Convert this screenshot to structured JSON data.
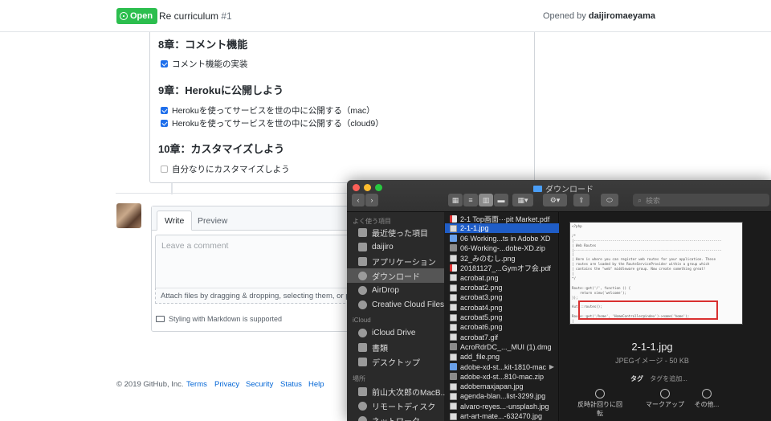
{
  "issue": {
    "state_label": "Open",
    "title": "Re curriculum",
    "number": "#1",
    "opened_by_prefix": "Opened by",
    "author": "daijiromaeyama"
  },
  "body": {
    "sections": [
      {
        "heading": "8章：コメント機能",
        "tasks": [
          {
            "text": "コメント機能の実装",
            "checked": true
          }
        ]
      },
      {
        "heading": "9章：Herokuに公開しよう",
        "tasks": [
          {
            "text": "Herokuを使ってサービスを世の中に公開する（mac）",
            "checked": true
          },
          {
            "text": "Herokuを使ってサービスを世の中に公開する（cloud9）",
            "checked": true
          }
        ]
      },
      {
        "heading": "10章：カスタマイズしよう",
        "tasks": [
          {
            "text": "自分なりにカスタマイズしよう",
            "checked": false
          }
        ]
      }
    ]
  },
  "new_comment": {
    "tab_write": "Write",
    "tab_preview": "Preview",
    "placeholder": "Leave a comment",
    "attach_text": "Attach files by dragging & dropping, selecting them, or p",
    "markdown_note": "Styling with Markdown is supported"
  },
  "footer": {
    "copyright": "© 2019 GitHub, Inc.",
    "links": [
      "Terms",
      "Privacy",
      "Security",
      "Status",
      "Help"
    ]
  },
  "finder": {
    "window_title": "ダウンロード",
    "search_placeholder": "検索",
    "sidebar": {
      "favorites_label": "よく使う項目",
      "favorites": [
        "最近使った項目",
        "daijiro",
        "アプリケーション",
        "ダウンロード",
        "AirDrop",
        "Creative Cloud Files"
      ],
      "selected": "ダウンロード",
      "icloud_label": "iCloud",
      "icloud": [
        "iCloud Drive",
        "書類",
        "デスクトップ"
      ],
      "places_label": "場所",
      "places": [
        "前山大次郎のMacB...",
        "リモートディスク",
        "ネットワーク"
      ]
    },
    "files": [
      {
        "name": "2-1 Top画面···pit Market.pdf",
        "kind": "pdf"
      },
      {
        "name": "2-1-1.jpg",
        "kind": "png",
        "selected": true
      },
      {
        "name": "06 Working...ts in Adobe XD",
        "kind": "app"
      },
      {
        "name": "06-Working-...dobe-XD.zip",
        "kind": "zip"
      },
      {
        "name": "32_みのむし.png",
        "kind": "png"
      },
      {
        "name": "20181127_...Gymオフ会.pdf",
        "kind": "pdf"
      },
      {
        "name": "acrobat.png",
        "kind": "png"
      },
      {
        "name": "acrobat2.png",
        "kind": "png"
      },
      {
        "name": "acrobat3.png",
        "kind": "png"
      },
      {
        "name": "acrobat4.png",
        "kind": "png"
      },
      {
        "name": "acrobat5.png",
        "kind": "png"
      },
      {
        "name": "acrobat6.png",
        "kind": "png"
      },
      {
        "name": "acrobat7.gif",
        "kind": "png"
      },
      {
        "name": "AcroRdrDC_..._MUI (1).dmg",
        "kind": "zip"
      },
      {
        "name": "add_file.png",
        "kind": "png"
      },
      {
        "name": "adobe-xd-st...kit-1810-mac",
        "kind": "app",
        "folder": true
      },
      {
        "name": "adobe-xd-st...810-mac.zip",
        "kind": "zip"
      },
      {
        "name": "adobemaxjapan.jpg",
        "kind": "png"
      },
      {
        "name": "agenda-blan...list-3299.jpg",
        "kind": "png"
      },
      {
        "name": "alvaro-reyes...-unsplash.jpg",
        "kind": "png"
      },
      {
        "name": "art-art-mate...-632470.jpg",
        "kind": "png"
      }
    ],
    "preview": {
      "filename": "2-1-1.jpg",
      "meta": "JPEGイメージ - 50 KB",
      "tag_label": "タグ",
      "tag_placeholder": "タグを追加...",
      "actions": [
        "反時計回りに回転",
        "マークアップ",
        "その他..."
      ]
    }
  },
  "colors": {
    "open_badge": "#2cbe4e",
    "link": "#0366d6",
    "finder_selection": "#1f5dc7",
    "highlight_box": "#d93030"
  }
}
